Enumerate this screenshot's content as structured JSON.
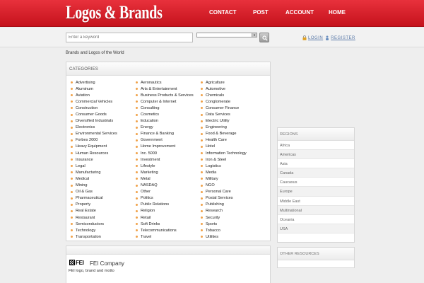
{
  "header": {
    "logo": "Logos & Brands",
    "nav": [
      "CONTACT",
      "POST",
      "ACCOUNT",
      "HOME"
    ]
  },
  "search": {
    "placeholder": "Enter a keyword",
    "select_value": ""
  },
  "auth": {
    "login": "LOGIN",
    "register": "REGISTER"
  },
  "tagline": "Brands and Logos of the World",
  "categories": {
    "title": "CATEGORIES",
    "col1": [
      "Advertising",
      "Aluminum",
      "Aviation",
      "Commercial Vehicles",
      "Construction",
      "Consumer Goods",
      "Diversified Industrials",
      "Electronics",
      "Environmental Services",
      "Forbes 2000",
      "Heavy Equipment",
      "Human Resources",
      "Insurance",
      "Legal",
      "Manufacturing",
      "Medical",
      "Mining",
      "Oil & Gas",
      "Pharmaceutical",
      "Property",
      "Real Estate",
      "Restaurant",
      "Semiconductors",
      "Technology",
      "Transportation"
    ],
    "col2": [
      "Aeronautics",
      "Arts & Entertainment",
      "Business Products & Services",
      "Computer & Internet",
      "Consulting",
      "Cosmetics",
      "Education",
      "Energy",
      "Finance & Banking",
      "Government",
      "Home Improvement",
      "Inc. 5000",
      "Investment",
      "Lifestyle",
      "Marketing",
      "Metal",
      "NASDAQ",
      "Other",
      "Politics",
      "Public Relations",
      "Religion",
      "Retail",
      "Soft Drinks",
      "Telecommunications",
      "Travel"
    ],
    "col3": [
      "Agriculture",
      "Automotive",
      "Chemicals",
      "Conglomerate",
      "Consumer Finance",
      "Data Services",
      "Electric Utility",
      "Engineering",
      "Food & Beverage",
      "Health Care",
      "Hotel",
      "Information Technology",
      "Iron & Steel",
      "Logistics",
      "Media",
      "Military",
      "NGO",
      "Personal Care",
      "Postal Services",
      "Publishing",
      "Research",
      "Security",
      "Sports",
      "Tobacco",
      "Utilities"
    ]
  },
  "regions": {
    "title": "REGIONS",
    "items": [
      "Africa",
      "Americas",
      "Asia",
      "Canada",
      "Caucasus",
      "Europe",
      "Middle East",
      "Multinational",
      "Oceania",
      "USA"
    ]
  },
  "other_resources": {
    "title": "OTHER RESOURCES"
  },
  "featured": {
    "logo_text": "FEI",
    "name": "FEI Company",
    "description": "FEI logo, brand and motto"
  },
  "colors": {
    "header_red": "#d9232d",
    "bullet_orange": "#f0a24a",
    "link_blue": "#5a7aa8"
  }
}
